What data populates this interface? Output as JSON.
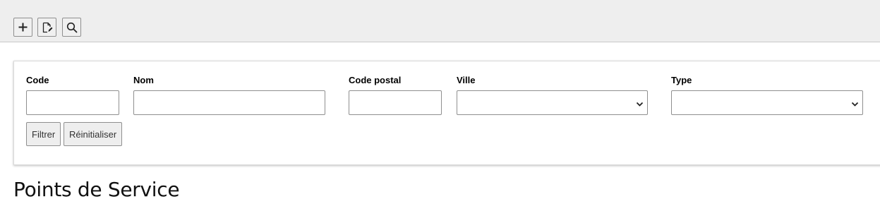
{
  "toolbar": {
    "buttons": [
      {
        "name": "add",
        "icon": "plus-icon"
      },
      {
        "name": "edit",
        "icon": "edit-document-icon"
      },
      {
        "name": "search",
        "icon": "search-icon"
      }
    ]
  },
  "filters": {
    "code": {
      "label": "Code",
      "value": ""
    },
    "nom": {
      "label": "Nom",
      "value": ""
    },
    "code_postal": {
      "label": "Code postal",
      "value": ""
    },
    "ville": {
      "label": "Ville",
      "selected": ""
    },
    "type": {
      "label": "Type",
      "selected": ""
    },
    "filter_button": "Filtrer",
    "reset_button": "Réinitialiser"
  },
  "page": {
    "title": "Points de Service"
  },
  "colors": {
    "toolbar_bg": "#eeeeee",
    "button_bg": "#eeeeee",
    "border": "#8f8f8f"
  }
}
